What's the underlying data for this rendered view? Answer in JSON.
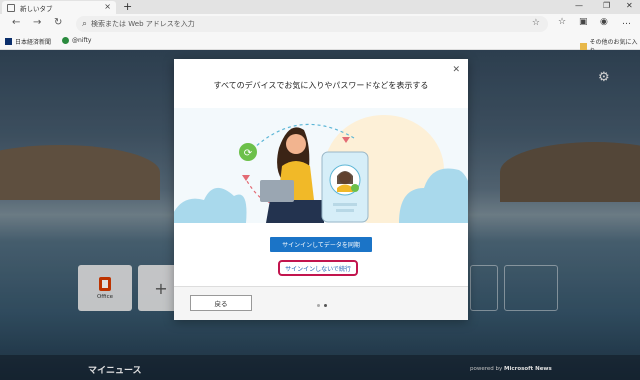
{
  "browser": {
    "tab": {
      "title": "新しいタブ",
      "close": "×"
    },
    "new_tab": "+",
    "window_controls": {
      "minimize": "—",
      "maximize": "❐",
      "close": "✕"
    },
    "nav": {
      "back": "←",
      "forward": "→",
      "refresh": "↻"
    },
    "address": {
      "placeholder": "検索または Web アドレスを入力",
      "icon": "search-icon"
    },
    "favorites": [
      {
        "label": "日本経済新聞",
        "color": "#0b2e6b"
      },
      {
        "label": "@nifty",
        "color": "#2a8a3e"
      }
    ],
    "other_favorites": "その他のお気に入り"
  },
  "page": {
    "tiles": [
      {
        "label": "Office",
        "icon": "office-icon"
      },
      {
        "label": "+",
        "icon": "plus-icon"
      }
    ],
    "news": {
      "title": "マイニュース",
      "powered_prefix": "powered by ",
      "powered_brand": "Microsoft News"
    }
  },
  "modal": {
    "title": "すべてのデバイスでお気に入りやパスワードなどを表示する",
    "primary_button": "サインインしてデータを同期",
    "secondary_link": "サインインしないで続行",
    "back_button": "戻る",
    "pagination": {
      "current": 1,
      "total": 2
    },
    "colors": {
      "primary": "#1b74c7",
      "highlight": "#c2154e",
      "link": "#1b5fb5"
    }
  }
}
